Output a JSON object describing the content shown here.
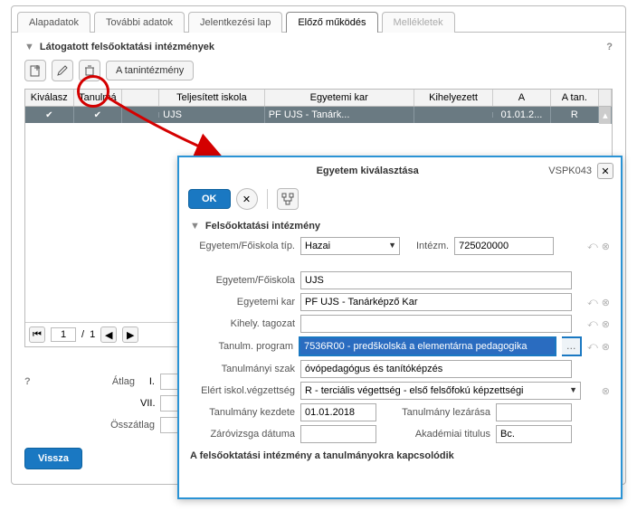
{
  "tabs": {
    "t0": "Alapadatok",
    "t1": "További adatok",
    "t2": "Jelentkezési lap",
    "t3": "Előző működés",
    "t4": "Mellékletek"
  },
  "section_title": "Látogatott felsőoktatási intézmények",
  "toolbar": {
    "institute_btn": "A tanintézmény"
  },
  "grid": {
    "h0": "Kiválasz",
    "h1": "Tanulmá",
    "h2": "",
    "h3": "Teljesített iskola",
    "h4": "Egyetemi kar",
    "h5": "Kihelyezett",
    "h6": "A",
    "h7": "A tan.",
    "row": {
      "c3": "UJS",
      "c4": "PF UJS - Tanárk...",
      "c6": "01.01.2...",
      "c7": "R"
    }
  },
  "pager": {
    "cur": "1",
    "total": "1"
  },
  "bottom": {
    "avg_label": "Átlag",
    "ovr_label": "Összátlag",
    "r0": "I.",
    "r1": "VII.",
    "back": "Vissza"
  },
  "dialog": {
    "title": "Egyetem kiválasztása",
    "code": "VSPK043",
    "ok": "OK",
    "sec": "Felsőoktatási intézmény",
    "l_type": "Egyetem/Főiskola típ.",
    "v_type": "Hazai",
    "l_inst": "Intézm.",
    "v_inst": "725020000",
    "l_univ": "Egyetem/Főiskola",
    "v_univ": "UJS",
    "l_fac": "Egyetemi kar",
    "v_fac": "PF UJS - Tanárképző Kar",
    "l_kih": "Kihely. tagozat",
    "v_kih": "",
    "l_prog": "Tanulm. program",
    "v_prog": "7536R00 - predškolská a elementárna pedagogika",
    "l_szak": "Tanulmányi szak",
    "v_szak": "óvópedagógus és tanítóképzés",
    "l_elert": "Elért iskol.végzettség",
    "v_elert": "R - terciális végettség - első felsőfokú képzettségi",
    "l_start": "Tanulmány kezdete",
    "v_start": "01.01.2018",
    "l_end": "Tanulmány lezárása",
    "v_end": "",
    "l_zaro": "Záróvizsga dátuma",
    "v_zaro": "",
    "l_akad": "Akadémiai titulus",
    "v_akad": "Bc.",
    "note": "A felsőoktatási intézmény a tanulmányokra kapcsolódik"
  }
}
